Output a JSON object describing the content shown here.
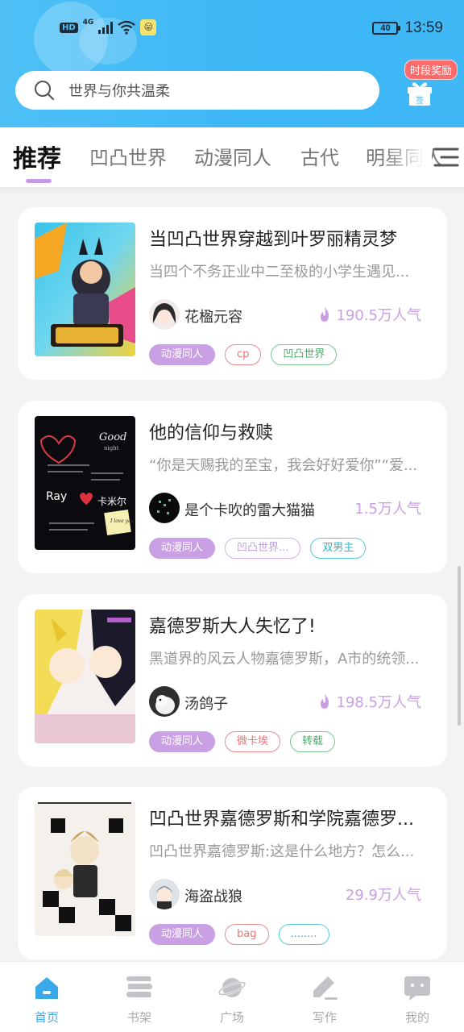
{
  "status_bar": {
    "hd": "HD",
    "network": "4G",
    "notification": "😛",
    "battery": "40",
    "time": "13:59"
  },
  "search": {
    "placeholder": "世界与你共温柔"
  },
  "reward": {
    "badge": "时段奖励",
    "gift_label": "签"
  },
  "tabs": [
    {
      "label": "推荐",
      "active": true
    },
    {
      "label": "凹凸世界"
    },
    {
      "label": "动漫同人"
    },
    {
      "label": "古代"
    },
    {
      "label": "明星同人"
    }
  ],
  "books": [
    {
      "title": "当凹凸世界穿越到叶罗丽精灵梦",
      "desc": "当四个不务正业中二至极的小学生遇见...",
      "author": "花楹元容",
      "popularity": "190.5万人气",
      "hot": true,
      "tags": [
        "动漫同人",
        "cp",
        "凹凸世界"
      ]
    },
    {
      "title": "他的信仰与救赎",
      "desc": "“你是天赐我的至宝，我会好好爱你”“爱...",
      "author": "是个卡吹的雷大猫猫",
      "popularity": "1.5万人气",
      "hot": false,
      "tags": [
        "动漫同人",
        "凹凸世界...",
        "双男主"
      ],
      "cover_text": {
        "title": "Good",
        "sub": "night",
        "name_a": "Ray",
        "name_b": "卡米尔",
        "note": "I love you"
      }
    },
    {
      "title": "嘉德罗斯大人失忆了!",
      "desc": "黑道界的风云人物嘉德罗斯，A市的统领...",
      "author": "汤鸽子",
      "popularity": "198.5万人气",
      "hot": true,
      "tags": [
        "动漫同人",
        "微卡埃",
        "转载"
      ]
    },
    {
      "title": "凹凸世界嘉德罗斯和学院嘉德罗...",
      "desc": "凹凸世界嘉德罗斯:这是什么地方？怎么...",
      "author": "海盗战狼",
      "popularity": "29.9万人气",
      "hot": false,
      "tags": [
        "动漫同人",
        "bag",
        "........"
      ]
    }
  ],
  "bottom_nav": [
    {
      "label": "首页",
      "icon": "home-icon",
      "active": true
    },
    {
      "label": "书架",
      "icon": "bookshelf-icon"
    },
    {
      "label": "广场",
      "icon": "planet-icon"
    },
    {
      "label": "写作",
      "icon": "pen-icon"
    },
    {
      "label": "我的",
      "icon": "chat-face-icon"
    }
  ],
  "colors": {
    "header": "#3cb6f5",
    "accent": "#c9a0e3",
    "nav_active": "#3aa9ea"
  }
}
